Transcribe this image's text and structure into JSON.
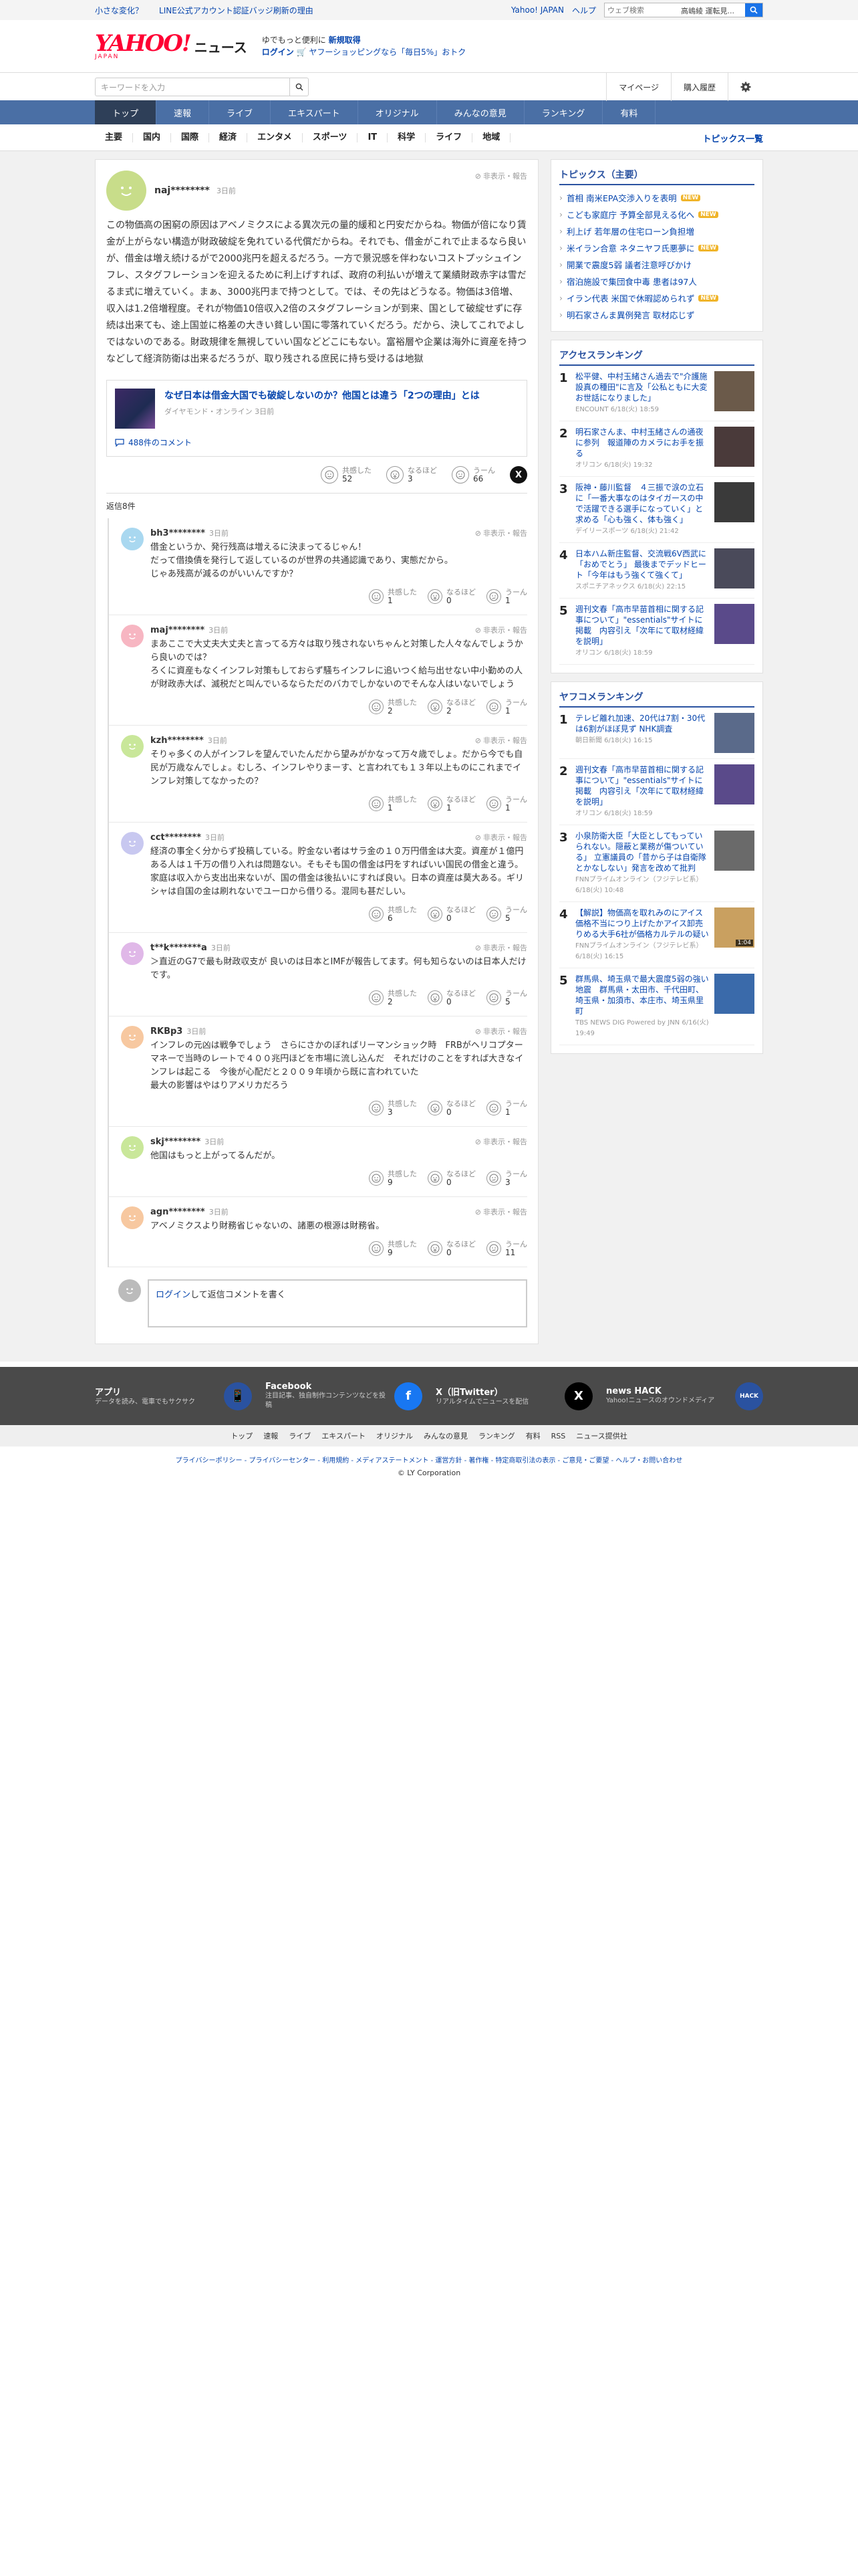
{
  "utility": {
    "link1": "小さな変化？",
    "link2": "LINE公式アカウント認証バッジ刷新の理由",
    "yahoo": "Yahoo! JAPAN",
    "help": "ヘルプ",
    "search_placeholder": "ウェブ検索",
    "search_tag": "高嶋綾 運転見..."
  },
  "brand": {
    "logo_main": "YAHOO!",
    "logo_sub": "JAPAN",
    "logo_news": "ニュース",
    "promo_line1_a": "ゆでもっと便利に",
    "promo_line1_b": "新規取得",
    "promo_line2_a": "ログイン",
    "promo_line2_b": "ヤフーショッピングなら「毎日5%」おトク"
  },
  "searchrow": {
    "placeholder": "キーワードを入力",
    "mypage": "マイページ",
    "history": "購入履歴"
  },
  "mainnav": [
    "トップ",
    "速報",
    "ライブ",
    "エキスパート",
    "オリジナル",
    "みんなの意見",
    "ランキング",
    "有料"
  ],
  "subnav": [
    "主要",
    "国内",
    "国際",
    "経済",
    "エンタメ",
    "スポーツ",
    "IT",
    "科学",
    "ライフ",
    "地域"
  ],
  "subnav_all": "トピックス一覧",
  "comment": {
    "user": "naj********",
    "ago": "3日前",
    "hide": "非表示・報告",
    "text": "この物価高の困窮の原因はアベノミクスによる異次元の量的緩和と円安だからね。物価が倍になり賃金が上がらない構造が財政破綻を免れている代償だからね。それでも、借金がこれで止まるなら良いが、借金は増え続けるがで2000兆円を超えるだろう。一方で景況感を伴わないコストプッシュインフレ、スタグフレーションを迎えるために利上げすれば、政府の利払いが増えて業績財政赤字は雪だるま式に増えていく。まぁ、3000兆円まで持つとして。では、その先はどうなる。物価は3倍増、収入は1.2倍増程度。それが物価10倍収入2倍のスタグフレーションが到来、国として破綻せずに存続は出来ても、途上国並に格差の大きい貧しい国に零落れていくだろう。だから、決してこれでよしではないのである。財政規律を無視していい国などどこにもない。富裕層や企業は海外に資産を持つなどして経済防衛は出来るだろうが、取り残される庶民に持ち受けるは地獄",
    "article_title": "なぜ日本は借金大国でも破綻しないのか？他国とは違う「2つの理由」とは",
    "article_src": "ダイヤモンド・オンライン",
    "article_ago": "3日前",
    "article_comments": "488件のコメント",
    "react_labels": [
      "共感した",
      "なるほど",
      "うーん"
    ],
    "react_counts": [
      "52",
      "3",
      "66"
    ],
    "reply_count": "返信8件"
  },
  "replies": [
    {
      "user": "bh3********",
      "ago": "3日前",
      "color": "#a9d8f0",
      "text": "借金というか、発行残高は増えるに決まってるじゃん！\nだって借換債を発行して返しているのが世界の共通認識であり、実態だから。\nじゃあ残高が減るのがいいんですか？",
      "counts": [
        "1",
        "0",
        "1"
      ]
    },
    {
      "user": "maj********",
      "ago": "3日前",
      "color": "#f7b6c2",
      "text": "まあここで大丈夫大丈夫と言ってる方々は取り残されないちゃんと対策した人々なんでしょうから良いのでは？\nろくに資産もなくインフレ対策もしておらず騒ちインフレに追いつく給与出せない中小勤めの人が財政赤大ぱ、滅税だと叫んでいるならただのバカでしかないのでそんな人はいないでしょう",
      "counts": [
        "2",
        "2",
        "1"
      ]
    },
    {
      "user": "kzh********",
      "ago": "3日前",
      "color": "#c9e79a",
      "text": "そりゃ多くの人がインフレを望んでいたんだから望みがかなって万々歳でしょ。だから今でも自民が万歳なんでしょ。むしろ、インフレやりまーす、と言われても１３年以上ものにこれまでインフレ対策してなかったの？",
      "counts": [
        "1",
        "1",
        "1"
      ]
    },
    {
      "user": "cct********",
      "ago": "3日前",
      "color": "#c8c8f0",
      "text": "経済の事全く分からず投稿している。貯金ない者はサラ金の１０万円借金は大変。資産が１億円ある人は１千万の借り入れは問題ない。そもそも国の借金は円をすればいい国民の借金と違う。家庭は収入から支出出来ないが、国の借金は後払いにすれば良い。日本の資産は莫大ある。ギリシャは自国の金は刷れないでユーロから借りる。混同も甚だしい。",
      "counts": [
        "6",
        "0",
        "5"
      ]
    },
    {
      "user": "t**k*******a",
      "ago": "3日前",
      "color": "#e0b8e8",
      "text": "＞直近のG7で最も財政収支が 良いのは日本とIMFが報告してます。何も知らないのは日本人だけです。",
      "counts": [
        "2",
        "0",
        "5"
      ]
    },
    {
      "user": "RKBp3",
      "ago": "3日前",
      "color": "#f7c8a0",
      "text": "インフレの元凶は戦争でしょう　さらにさかのぼればリーマンショック時　FRBがヘリコプターマネーで当時のレートで４００兆円ほどを市場に流し込んだ　それだけのことをすれば大きなインフレは起こる　今後が心配だと２００９年頃から既に言われていた\n最大の影響はやはりアメリカだろう",
      "counts": [
        "3",
        "0",
        "1"
      ]
    },
    {
      "user": "skj********",
      "ago": "3日前",
      "color": "#c9e79a",
      "text": "他国はもっと上がってるんだが。",
      "counts": [
        "9",
        "0",
        "3"
      ]
    },
    {
      "user": "agn********",
      "ago": "3日前",
      "color": "#f7c8a0",
      "text": "アベノミクスより財務省じゃないの、諸悪の根源は財務省。",
      "counts": [
        "9",
        "0",
        "11"
      ]
    }
  ],
  "replybox": {
    "login": "ログイン",
    "rest": "して返信コメントを書く"
  },
  "sidebar": {
    "topics_title": "トピックス（主要）",
    "topics": [
      {
        "t": "首相 南米EPA交渉入りを表明",
        "new": "NEW"
      },
      {
        "t": "こども家庭庁 予算全部見える化へ",
        "new": "NEW"
      },
      {
        "t": "利上げ 若年層の住宅ローン負担増",
        "new": ""
      },
      {
        "t": "米イラン合意 ネタニヤフ氏悪夢に",
        "new": "NEW"
      },
      {
        "t": "開業で震度5弱 議者注意呼びかけ",
        "new": ""
      },
      {
        "t": "宿泊施設で集団食中毒 患者は97人",
        "new": ""
      },
      {
        "t": "イラン代表 米国で休暇認められず",
        "new": "NEW"
      },
      {
        "t": "明石家さんま異例発言 取材応じず",
        "new": ""
      }
    ],
    "access_title": "アクセスランキング",
    "access": [
      {
        "n": "1",
        "t": "松平健、中村玉緒さん過去で\"介護施設真の種田\"に言及「公私ともに大変お世話になりました」",
        "m": "ENCOUNT 6/18(火) 18:59",
        "c": "#6b5a4a"
      },
      {
        "n": "2",
        "t": "明石家さんま、中村玉緒さんの通夜に参列　報道陣のカメラにお手を振る",
        "m": "オリコン 6/18(火) 19:32",
        "c": "#4a3a3a"
      },
      {
        "n": "3",
        "t": "阪神・藤川監督　４三振で涙の立石に「一番大事なのはタイガースの中で活躍できる選手になっていく」と求める「心も強く、体も強く」",
        "m": "デイリースポーツ 6/18(火) 21:42",
        "c": "#3a3a3a"
      },
      {
        "n": "4",
        "t": "日本ハム新庄監督、交流戦6V西武に「おめでとう」 最後までデッドヒート「今年はもう強くて強くて」",
        "m": "スポニチアネックス 6/18(火) 22:15",
        "c": "#4a4a5a"
      },
      {
        "n": "5",
        "t": "週刊文春「高市早苗首相に関する記事について」\"essentials\"サイトに掲載　内容引え「次年にて取材経緯を説明」",
        "m": "オリコン 6/18(火) 18:59",
        "c": "#5a4a8a"
      }
    ],
    "yafoo_title": "ヤフコメランキング",
    "yafoo": [
      {
        "n": "1",
        "t": "テレビ離れ加速、20代は7割・30代は6割がほぼ見ず NHK調査",
        "m": "朝日新聞 6/18(火) 16:15",
        "c": "#5a6a8a"
      },
      {
        "n": "2",
        "t": "週刊文春「高市早苗首相に関する記事について」\"essentials\"サイトに掲載　内容引え「次年にて取材経緯を説明」",
        "m": "オリコン 6/18(火) 18:59",
        "c": "#5a4a8a"
      },
      {
        "n": "3",
        "t": "小泉防衛大臣「大臣としてもっていられない。隠蔽と業務が傷ついている」 立憲議員の「昔から子は自衛隊とかなしない」発言を改めて批判",
        "m": "FNNプライムオンライン（フジテレビ系） 6/18(火) 10:48",
        "c": "#6a6a6a"
      },
      {
        "n": "4",
        "t": "【解説】物価高を取れみのにアイス価格不当につり上げたかアイス卸売りめる大手6社が価格カルテルの疑い",
        "m": "FNNプライムオンライン（フジテレビ系） 6/18(火) 16:15",
        "c": "#c9a060",
        "dur": "1:04"
      },
      {
        "n": "5",
        "t": "群馬県、埼玉県で最大震度5弱の強い地震　群馬県・太田市、千代田町、埼玉県・加須市、本庄市、埼玉県里町",
        "m": "TBS NEWS DIG Powered by JNN 6/16(火) 19:49",
        "c": "#3a6aaa"
      }
    ]
  },
  "footer": {
    "apps": [
      {
        "t": "アプリ",
        "d": "データを読み、電車でもサクサク",
        "ic": "#2a52a0"
      },
      {
        "t": "Facebook",
        "d": "注目記事、独自制作コンテンツなどを投稿",
        "ic": "#1877f2"
      },
      {
        "t": "X（旧Twitter）",
        "d": "リアルタイムでニュースを配信",
        "ic": "#000000"
      },
      {
        "t": "news HACK",
        "d": "Yahoo!ニュースのオウンドメディア",
        "ic": "#2a52a0"
      }
    ],
    "nav": [
      "トップ",
      "速報",
      "ライブ",
      "エキスパート",
      "オリジナル",
      "みんなの意見",
      "ランキング",
      "有料",
      "RSS",
      "ニュース提供社"
    ],
    "links": "プライバシーポリシー - プライバシーセンター - 利用規約 - メディアステートメント - 運営方針 - 著作権 - 特定商取引法の表示 - ご意見・ご要望 - ヘルプ・お問い合わせ",
    "copy": "© LY Corporation"
  },
  "colors": {
    "accent": "#4a6fa5",
    "link": "#0645ad",
    "brand": "#ff0033"
  }
}
